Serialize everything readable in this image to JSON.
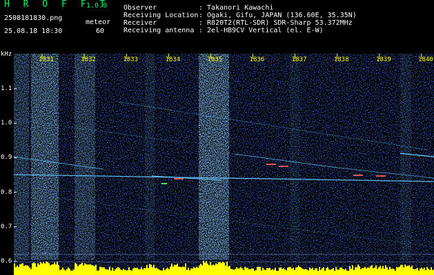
{
  "header": {
    "app_name": "H R O F F T",
    "version": "1.0.0",
    "filename": "2508181830.png",
    "datetime": "25.08.18 18:30",
    "count_label": "meteor",
    "count_value": "60",
    "fields": [
      {
        "label": "Observer",
        "value": ": Takanori Kawachi"
      },
      {
        "label": "Receiving Location",
        "value": ": Ogaki, Gifu, JAPAN (136.60E, 35.35N)"
      },
      {
        "label": "Receiver",
        "value": ": R820T2(RTL-SDR) SDR-Sharp 53.372MHz"
      },
      {
        "label": "Receiving antenna",
        "value": ": 2el-HB9CV Vertical (el. E-W)"
      }
    ]
  },
  "plot": {
    "y_unit": "kHz",
    "y_ticks": [
      "1.1",
      "1.0",
      "0.9",
      "0.8",
      "0.7",
      "0.6"
    ],
    "x_ticks": [
      "1831",
      "1832",
      "1833",
      "1834",
      "1835",
      "1836",
      "1837",
      "1838",
      "1839",
      "1840"
    ],
    "colors": {
      "background": "#000000",
      "noise": "#1b3fa8",
      "streak": "#66ccff",
      "hot": "#ff6666",
      "level": "#ffff00",
      "tick": "#ffff00"
    }
  }
}
